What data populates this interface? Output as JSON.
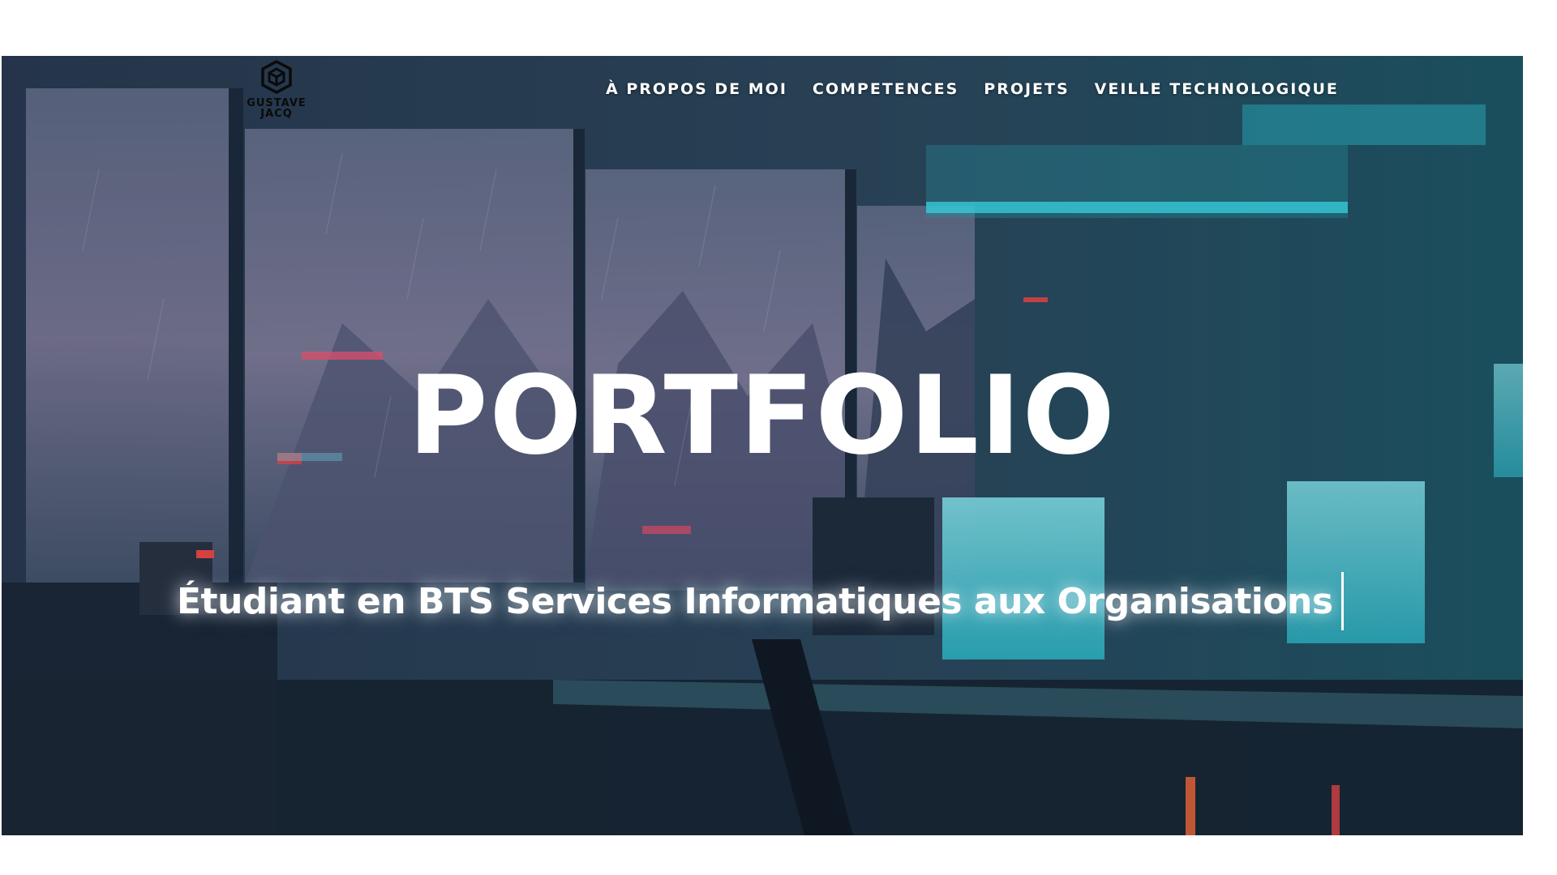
{
  "header": {
    "logo_text_line1": "GUSTAVE",
    "logo_text_line2": "JACQ",
    "logo_icon": "cube-logo-icon",
    "nav": [
      {
        "label": "À PROPOS DE MOI"
      },
      {
        "label": "COMPETENCES"
      },
      {
        "label": "PROJETS"
      },
      {
        "label": "VEILLE TECHNOLOGIQUE"
      }
    ]
  },
  "hero": {
    "title": "PORTFOLIO",
    "subtitle": "Étudiant en BTS Services Informatiques aux Organisations",
    "background": "cyberpunk-office-illustration"
  },
  "colors": {
    "text": "#ffffff",
    "accent_cyan": "#3ff0ff",
    "accent_red": "#ff4a4a",
    "scene_dark": "#1a2a3a"
  }
}
